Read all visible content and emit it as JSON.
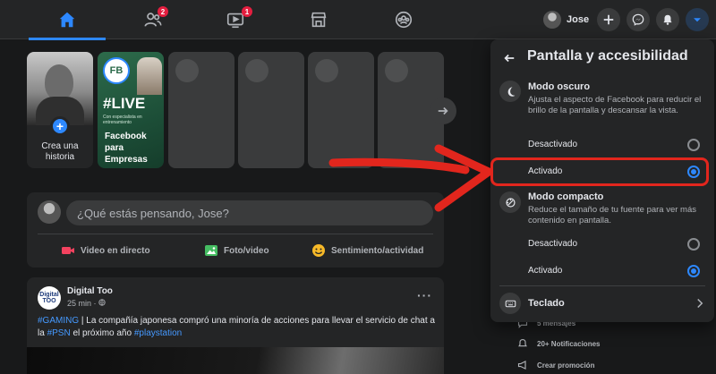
{
  "navbar": {
    "tabs": [
      {
        "icon": "home-icon",
        "badge": ""
      },
      {
        "icon": "friends-icon",
        "badge": "2"
      },
      {
        "icon": "watch-icon",
        "badge": "1"
      },
      {
        "icon": "marketplace-icon",
        "badge": ""
      },
      {
        "icon": "groups-icon",
        "badge": ""
      }
    ],
    "profile_name": "Jose",
    "accent": "#2d88ff"
  },
  "stories": {
    "create_label": "Crea una historia",
    "live": {
      "badge": "FB",
      "title": "#LIVE",
      "subtitle": "Con especialista en entrenamiento",
      "name": "Facebook para Empresas"
    }
  },
  "composer": {
    "placeholder": "¿Qué estás pensando, Jose?",
    "actions": [
      {
        "label": "Video en directo",
        "color": "#f3425f"
      },
      {
        "label": "Foto/video",
        "color": "#45bd62"
      },
      {
        "label": "Sentimiento/actividad",
        "color": "#f7b928"
      }
    ]
  },
  "post": {
    "avatar_text": "Digital TOO",
    "author": "Digital Too",
    "time": "25 min · ",
    "text": {
      "tag1": "#GAMING",
      "part1": " | La compañía japonesa compró una minoría de acciones para llevar el servicio de chat a la ",
      "tag2": "#PSN",
      "part2": " el próximo año ",
      "tag3": "#playstation"
    }
  },
  "sidebar_bg": {
    "item1": "5 mensajes",
    "item2": "20+ Notificaciones",
    "item3": "Crear promoción"
  },
  "panel": {
    "title": "Pantalla y accesibilidad",
    "dark_mode": {
      "title": "Modo oscuro",
      "description": "Ajusta el aspecto de Facebook para reducir el brillo de la pantalla y descansar la vista.",
      "off_label": "Desactivado",
      "on_label": "Activado",
      "selected": "on"
    },
    "compact_mode": {
      "title": "Modo compacto",
      "description": "Reduce el tamaño de tu fuente para ver más contenido en pantalla.",
      "off_label": "Desactivado",
      "on_label": "Activado",
      "selected": "on"
    },
    "keyboard_label": "Teclado",
    "annotation_color": "#e2261d"
  }
}
